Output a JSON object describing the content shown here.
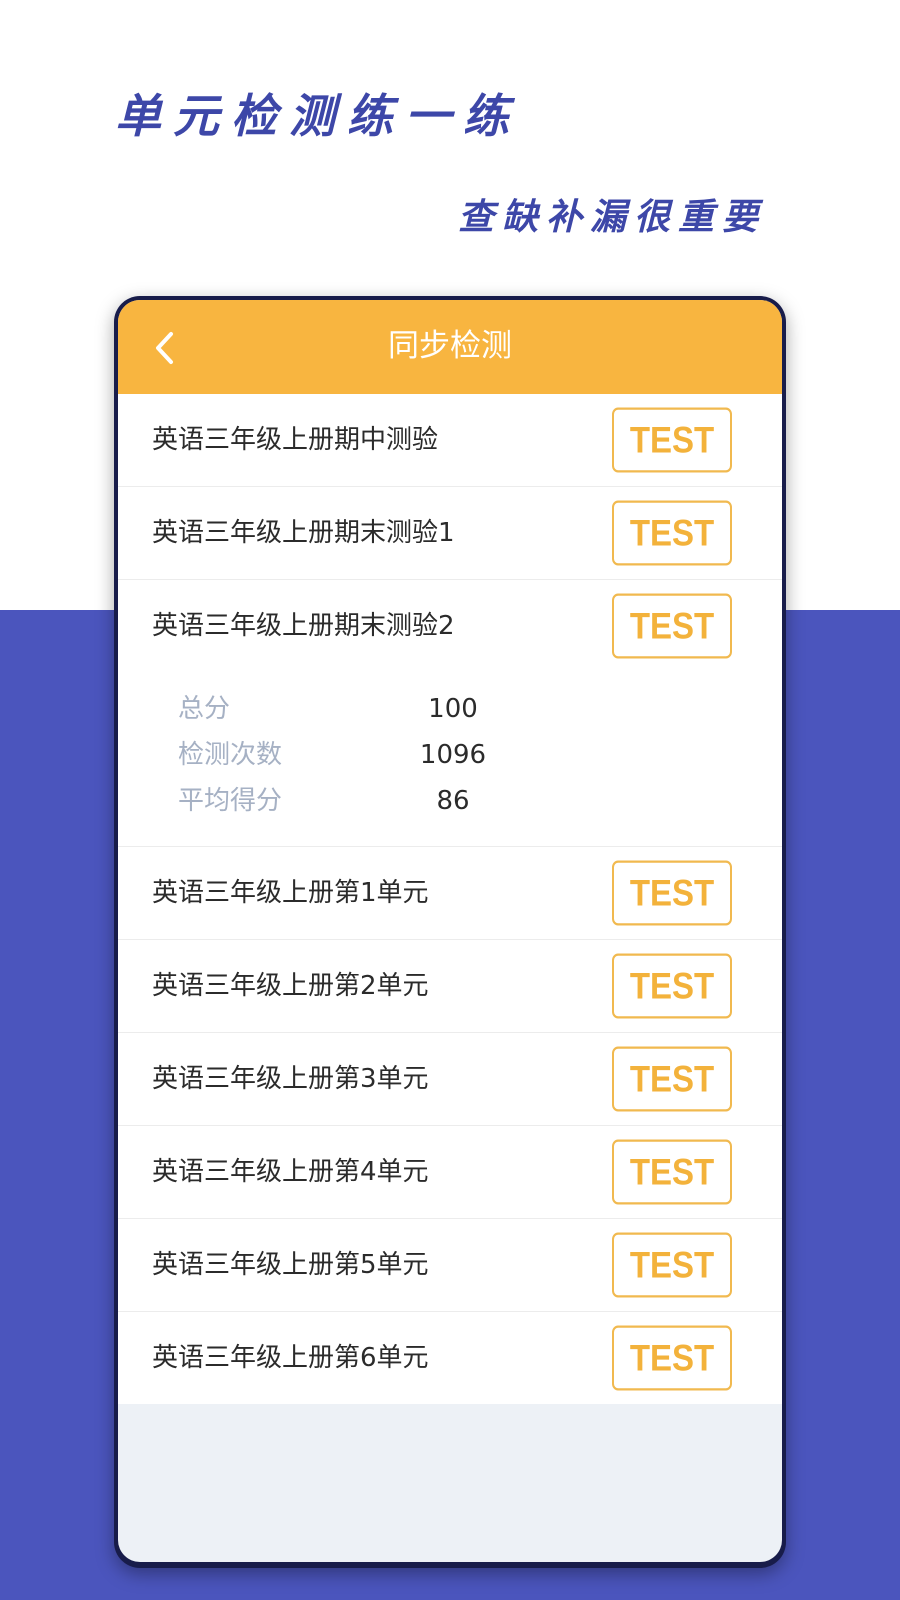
{
  "promo": {
    "headline": "单元检测练一练",
    "subline": "查缺补漏很重要"
  },
  "appbar": {
    "title": "同步检测",
    "back_icon": "chevron-left-icon"
  },
  "colors": {
    "accent": "#f8b540",
    "background_bottom": "#4b55bd",
    "headline": "#3d47a8"
  },
  "tests": [
    {
      "title": "英语三年级上册期中测验",
      "button": "TEST"
    },
    {
      "title": "英语三年级上册期末测验1",
      "button": "TEST"
    },
    {
      "title": "英语三年级上册期末测验2",
      "button": "TEST"
    },
    {
      "title": "英语三年级上册第1单元",
      "button": "TEST"
    },
    {
      "title": "英语三年级上册第2单元",
      "button": "TEST"
    },
    {
      "title": "英语三年级上册第3单元",
      "button": "TEST"
    },
    {
      "title": "英语三年级上册第4单元",
      "button": "TEST"
    },
    {
      "title": "英语三年级上册第5单元",
      "button": "TEST"
    },
    {
      "title": "英语三年级上册第6单元",
      "button": "TEST"
    }
  ],
  "expanded_stats": {
    "total_label": "总分",
    "total_value": "100",
    "count_label": "检测次数",
    "count_value": "1096",
    "avg_label": "平均得分",
    "avg_value": "86"
  }
}
